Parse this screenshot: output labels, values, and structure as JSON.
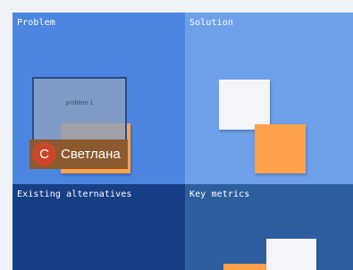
{
  "board": {
    "frames": {
      "problem": {
        "label": "Problem",
        "color": "#4c86e0"
      },
      "solution": {
        "label": "Solution",
        "color": "#6fa1ea"
      },
      "existing_alternatives": {
        "label": "Existing alternatives",
        "color": "#173f86"
      },
      "key_metrics": {
        "label": "Key metrics",
        "color": "#2d5f9e"
      }
    },
    "stickies": {
      "problem_selected_text": "problem 1"
    },
    "sticky_colors": {
      "orange": "#ffa24a",
      "white": "#f3f5f8"
    }
  },
  "collaborator": {
    "initial": "С",
    "name": "Светлана",
    "avatar_color": "#c9462b"
  }
}
